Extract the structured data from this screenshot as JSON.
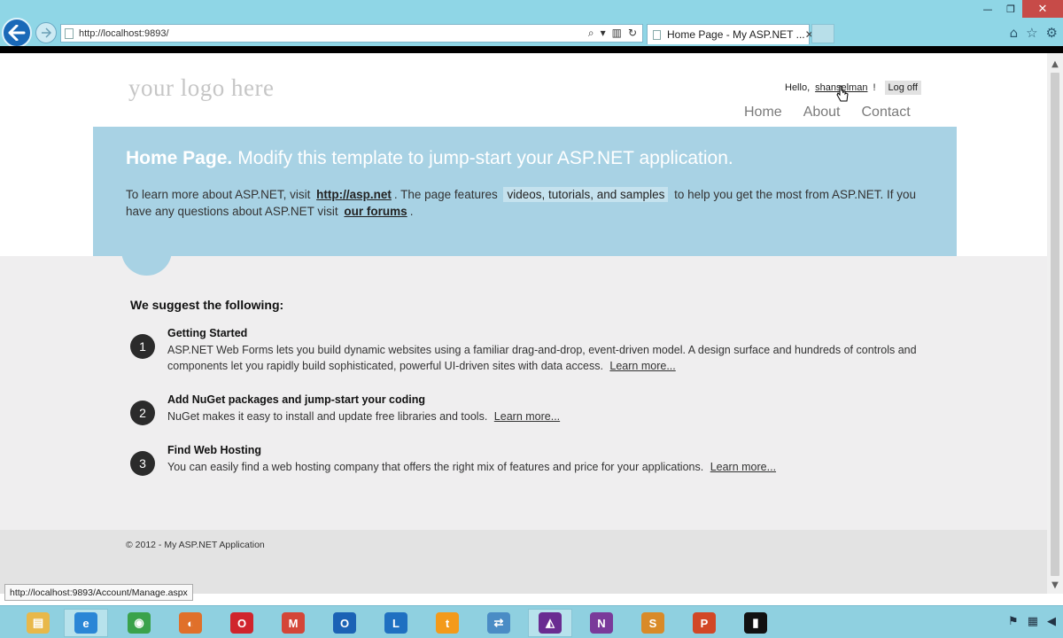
{
  "browser": {
    "url": "http://localhost:9893/",
    "tab_title": "Home Page - My ASP.NET ...",
    "tab_close": "✕",
    "window": {
      "minimize": "—",
      "restore": "❐",
      "close": "✕"
    },
    "toolbar": {
      "search": "⌕",
      "dropdown": "▾",
      "compat": "▥",
      "refresh": "↻"
    },
    "right_icons": {
      "home": "⌂",
      "favorites": "☆",
      "tools": "⚙"
    },
    "status_url": "http://localhost:9893/Account/Manage.aspx"
  },
  "site": {
    "logo": "your logo here",
    "login": {
      "hello": "Hello,",
      "user": "shanselman",
      "exclaim": "!",
      "logoff": "Log off"
    },
    "menu": [
      "Home",
      "About",
      "Contact"
    ]
  },
  "featured": {
    "title_bold": "Home Page.",
    "title_rest": "Modify this template to jump-start your ASP.NET application.",
    "text1": "To learn more about ASP.NET, visit",
    "link1": "http://asp.net",
    "text2": ". The page features",
    "highlight": "videos, tutorials, and samples",
    "text3": "to help you get the most from ASP.NET. If you have any questions about ASP.NET visit",
    "link2": "our forums",
    "text4": "."
  },
  "suggest_heading": "We suggest the following:",
  "steps": [
    {
      "num": "1",
      "title": "Getting Started",
      "desc": "ASP.NET Web Forms lets you build dynamic websites using a familiar drag-and-drop, event-driven model. A design surface and hundreds of controls and components let you rapidly build sophisticated, powerful UI-driven sites with data access.",
      "more": "Learn more..."
    },
    {
      "num": "2",
      "title": "Add NuGet packages and jump-start your coding",
      "desc": "NuGet makes it easy to install and update free libraries and tools.",
      "more": "Learn more..."
    },
    {
      "num": "3",
      "title": "Find Web Hosting",
      "desc": "You can easily find a web hosting company that offers the right mix of features and price for your applications.",
      "more": "Learn more..."
    }
  ],
  "footer": "© 2012 - My ASP.NET Application",
  "taskbar": {
    "apps": [
      {
        "name": "explorer",
        "letter": "▤",
        "color": "#e8b84a"
      },
      {
        "name": "internet-explorer",
        "letter": "e",
        "color": "#2a86d6"
      },
      {
        "name": "chrome",
        "letter": "◉",
        "color": "#3aa24b"
      },
      {
        "name": "firefox",
        "letter": "◐",
        "color": "#e0702a"
      },
      {
        "name": "opera",
        "letter": "O",
        "color": "#d0242c"
      },
      {
        "name": "gmail",
        "letter": "M",
        "color": "#d44638"
      },
      {
        "name": "outlook",
        "letter": "O",
        "color": "#1b62b5"
      },
      {
        "name": "lync",
        "letter": "L",
        "color": "#1f70c1"
      },
      {
        "name": "twitter-client",
        "letter": "t",
        "color": "#f39a1a"
      },
      {
        "name": "remote-desktop",
        "letter": "⇄",
        "color": "#4a8cc5"
      },
      {
        "name": "visual-studio",
        "letter": "◭",
        "color": "#6a2c91"
      },
      {
        "name": "onenote",
        "letter": "N",
        "color": "#7a3a9a"
      },
      {
        "name": "sublime",
        "letter": "S",
        "color": "#d98a28"
      },
      {
        "name": "powerpoint",
        "letter": "P",
        "color": "#d24726"
      },
      {
        "name": "command-prompt",
        "letter": "▮",
        "color": "#111111"
      }
    ],
    "tray": {
      "flag": "⚑",
      "network": "▦",
      "volume": "◀"
    }
  }
}
